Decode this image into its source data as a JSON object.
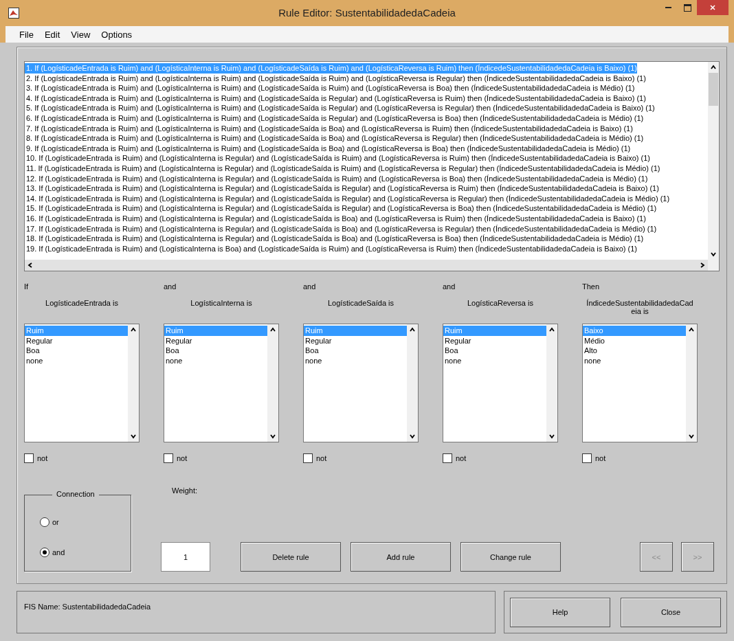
{
  "window": {
    "title": "Rule Editor: SustentabilidadedaCadeia"
  },
  "menu": [
    "File",
    "Edit",
    "View",
    "Options"
  ],
  "rules": [
    {
      "text": "1. If (LogísticadeEntrada is Ruim) and (LogísticaInterna is Ruim) and (LogísticadeSaída is Ruim) and (LogísticaReversa is Ruim) then (ÍndicedeSustentabilidadedaCadeia is Baixo) (1)",
      "selected": true
    },
    {
      "text": "2. If (LogísticadeEntrada is Ruim) and (LogísticaInterna is Ruim) and (LogísticadeSaída is Ruim) and (LogísticaReversa is Regular) then (ÍndicedeSustentabilidadedaCadeia is Baixo) (1)",
      "selected": false
    },
    {
      "text": "3. If (LogísticadeEntrada is Ruim) and (LogísticaInterna is Ruim) and (LogísticadeSaída is Ruim) and (LogísticaReversa is Boa) then (ÍndicedeSustentabilidadedaCadeia is Médio) (1)",
      "selected": false
    },
    {
      "text": "4. If (LogísticadeEntrada is Ruim) and (LogísticaInterna is Ruim) and (LogísticadeSaída is Regular) and (LogísticaReversa is Ruim) then (ÍndicedeSustentabilidadedaCadeia is Baixo) (1)",
      "selected": false
    },
    {
      "text": "5. If (LogísticadeEntrada is Ruim) and (LogísticaInterna is Ruim) and (LogísticadeSaída is Regular) and (LogísticaReversa is Regular) then (ÍndicedeSustentabilidadedaCadeia is Baixo) (1)",
      "selected": false
    },
    {
      "text": "6. If (LogísticadeEntrada is Ruim) and (LogísticaInterna is Ruim) and (LogísticadeSaída is Regular) and (LogísticaReversa is Boa) then (ÍndicedeSustentabilidadedaCadeia is Médio) (1)",
      "selected": false
    },
    {
      "text": "7. If (LogísticadeEntrada is Ruim) and (LogísticaInterna is Ruim) and (LogísticadeSaída is Boa) and (LogísticaReversa is Ruim) then (ÍndicedeSustentabilidadedaCadeia is Baixo) (1)",
      "selected": false
    },
    {
      "text": "8. If (LogísticadeEntrada is Ruim) and (LogísticaInterna is Ruim) and (LogísticadeSaída is Boa) and (LogísticaReversa is Regular) then (ÍndicedeSustentabilidadedaCadeia is Médio) (1)",
      "selected": false
    },
    {
      "text": "9. If (LogísticadeEntrada is Ruim) and (LogísticaInterna is Ruim) and (LogísticadeSaída is Boa) and (LogísticaReversa is Boa) then (ÍndicedeSustentabilidadedaCadeia is Médio) (1)",
      "selected": false
    },
    {
      "text": "10. If (LogísticadeEntrada is Ruim) and (LogísticaInterna is Regular) and (LogísticadeSaída is Ruim) and (LogísticaReversa is Ruim) then (ÍndicedeSustentabilidadedaCadeia is Baixo) (1)",
      "selected": false
    },
    {
      "text": "11. If (LogísticadeEntrada is Ruim) and (LogísticaInterna is Regular) and (LogísticadeSaída is Ruim) and (LogísticaReversa is Regular) then (ÍndicedeSustentabilidadedaCadeia is Médio) (1)",
      "selected": false
    },
    {
      "text": "12. If (LogísticadeEntrada is Ruim) and (LogísticaInterna is Regular) and (LogísticadeSaída is Ruim) and (LogísticaReversa is Boa) then (ÍndicedeSustentabilidadedaCadeia is Médio) (1)",
      "selected": false
    },
    {
      "text": "13. If (LogísticadeEntrada is Ruim) and (LogísticaInterna is Regular) and (LogísticadeSaída is Regular) and (LogísticaReversa is Ruim) then (ÍndicedeSustentabilidadedaCadeia is Baixo) (1)",
      "selected": false
    },
    {
      "text": "14. If (LogísticadeEntrada is Ruim) and (LogísticaInterna is Regular) and (LogísticadeSaída is Regular) and (LogísticaReversa is Regular) then (ÍndicedeSustentabilidadedaCadeia is Médio) (1)",
      "selected": false
    },
    {
      "text": "15. If (LogísticadeEntrada is Ruim) and (LogísticaInterna is Regular) and (LogísticadeSaída is Regular) and (LogísticaReversa is Boa) then (ÍndicedeSustentabilidadedaCadeia is Médio) (1)",
      "selected": false
    },
    {
      "text": "16. If (LogísticadeEntrada is Ruim) and (LogísticaInterna is Regular) and (LogísticadeSaída is Boa) and (LogísticaReversa is Ruim) then (ÍndicedeSustentabilidadedaCadeia is Baixo) (1)",
      "selected": false
    },
    {
      "text": "17. If (LogísticadeEntrada is Ruim) and (LogísticaInterna is Regular) and (LogísticadeSaída is Boa) and (LogísticaReversa is Regular) then (ÍndicedeSustentabilidadedaCadeia is Médio) (1)",
      "selected": false
    },
    {
      "text": "18. If (LogísticadeEntrada is Ruim) and (LogísticaInterna is Regular) and (LogísticadeSaída is Boa) and (LogísticaReversa is Boa) then (ÍndicedeSustentabilidadedaCadeia is Médio) (1)",
      "selected": false
    },
    {
      "text": "19. If (LogísticadeEntrada is Ruim) and (LogísticaInterna is Boa) and (LogísticadeSaída is Ruim) and (LogísticaReversa is Ruim) then (ÍndicedeSustentabilidadedaCadeia is Baixo) (1)",
      "selected": false
    }
  ],
  "columns": [
    {
      "connector": "If",
      "label": "LogísticadeEntrada is",
      "not": false,
      "not_label": "not",
      "options": [
        {
          "label": "Ruim",
          "selected": true
        },
        {
          "label": "Regular",
          "selected": false
        },
        {
          "label": "Boa",
          "selected": false
        },
        {
          "label": "none",
          "selected": false
        }
      ]
    },
    {
      "connector": "and",
      "label": "LogísticaInterna is",
      "not": false,
      "not_label": "not",
      "options": [
        {
          "label": "Ruim",
          "selected": true
        },
        {
          "label": "Regular",
          "selected": false
        },
        {
          "label": "Boa",
          "selected": false
        },
        {
          "label": "none",
          "selected": false
        }
      ]
    },
    {
      "connector": "and",
      "label": "LogísticadeSaída is",
      "not": false,
      "not_label": "not",
      "options": [
        {
          "label": "Ruim",
          "selected": true
        },
        {
          "label": "Regular",
          "selected": false
        },
        {
          "label": "Boa",
          "selected": false
        },
        {
          "label": "none",
          "selected": false
        }
      ]
    },
    {
      "connector": "and",
      "label": "LogísticaReversa is",
      "not": false,
      "not_label": "not",
      "options": [
        {
          "label": "Ruim",
          "selected": true
        },
        {
          "label": "Regular",
          "selected": false
        },
        {
          "label": "Boa",
          "selected": false
        },
        {
          "label": "none",
          "selected": false
        }
      ]
    },
    {
      "connector": "Then",
      "label": "ÍndicedeSustentabilidadedaCadeia is",
      "not": false,
      "not_label": "not",
      "options": [
        {
          "label": "Baixo",
          "selected": true
        },
        {
          "label": "Médio",
          "selected": false
        },
        {
          "label": "Alto",
          "selected": false
        },
        {
          "label": "none",
          "selected": false
        }
      ]
    }
  ],
  "connection": {
    "title": "Connection",
    "options": [
      {
        "label": "or",
        "selected": false
      },
      {
        "label": "and",
        "selected": true
      }
    ]
  },
  "weight": {
    "label": "Weight:",
    "value": "1"
  },
  "buttons": [
    "Delete rule",
    "Add rule",
    "Change rule"
  ],
  "nav_buttons": [
    {
      "label": "<<",
      "disabled": true
    },
    {
      "label": ">>",
      "disabled": true
    }
  ],
  "status": "FIS Name: SustentabilidadedaCadeia",
  "footer_buttons": [
    "Help",
    "Close"
  ]
}
